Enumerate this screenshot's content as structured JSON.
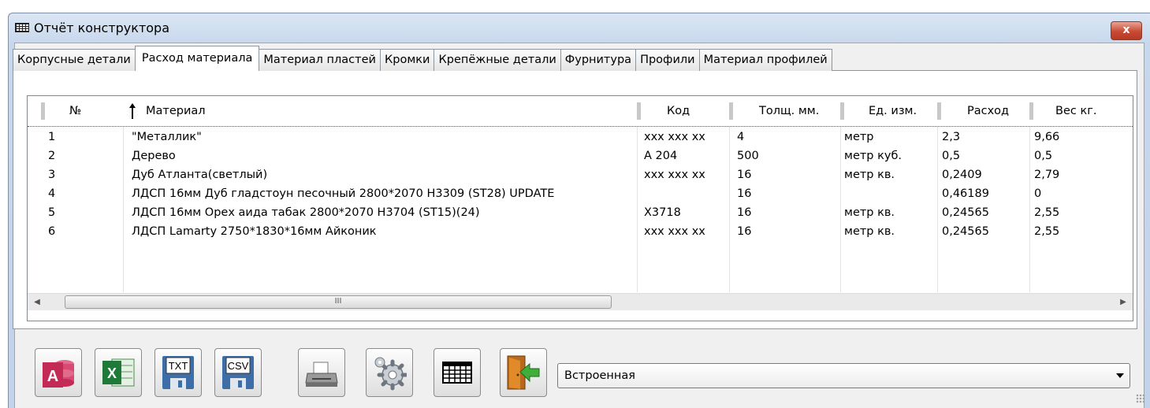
{
  "window": {
    "title": "Отчёт конструктора",
    "close_label": "x"
  },
  "tabs": [
    "Корпусные детали",
    "Расход материала",
    "Материал пластей",
    "Кромки",
    "Крепёжные детали",
    "Фурнитура",
    "Профили",
    "Материал профилей"
  ],
  "active_tab_index": 1,
  "table": {
    "columns": [
      "№",
      "Материал",
      "Код",
      "Толщ. мм.",
      "Ед. изм.",
      "Расход",
      "Вес кг."
    ],
    "sorted_column": "Материал",
    "rows": [
      [
        "1",
        "\"Металлик\"",
        "ххх ххх хх",
        "4",
        "метр",
        "2,3",
        "9,66"
      ],
      [
        "2",
        "Дерево",
        "А 204",
        "500",
        "метр куб.",
        "0,5",
        "0,5"
      ],
      [
        "3",
        "Дуб Атланта(светлый)",
        "ххх ххх хх",
        "16",
        "метр кв.",
        "0,2409",
        "2,79"
      ],
      [
        "4",
        "ЛДСП 16мм Дуб гладстоун песочный 2800*2070 H3309 (ST28) UPDATE",
        "",
        "16",
        "",
        "0,46189",
        "0"
      ],
      [
        "5",
        "ЛДСП 16мм Орех аида табак 2800*2070 H3704 (ST15)(24)",
        "Х3718",
        "16",
        "метр кв.",
        "0,24565",
        "2,55"
      ],
      [
        "6",
        "ЛДСП Lamarty 2750*1830*16мм Айконик",
        "ххх ххх хх",
        "16",
        "метр кв.",
        "0,24565",
        "2,55"
      ]
    ]
  },
  "scrollbar": {
    "thumb_label": "III"
  },
  "toolbar": {
    "buttons": [
      "export-access",
      "export-excel",
      "export-txt",
      "export-csv",
      "print",
      "settings",
      "table-view",
      "exit"
    ],
    "txt_label": "TXT",
    "csv_label": "CSV",
    "access_label": "A",
    "excel_label": "X"
  },
  "source_select": {
    "value": "Встроенная"
  },
  "colors": {
    "access": "#c32a55",
    "excel": "#1f7a3a",
    "floppy": "#3d6ea8",
    "exit_arrow": "#3fae3a"
  }
}
